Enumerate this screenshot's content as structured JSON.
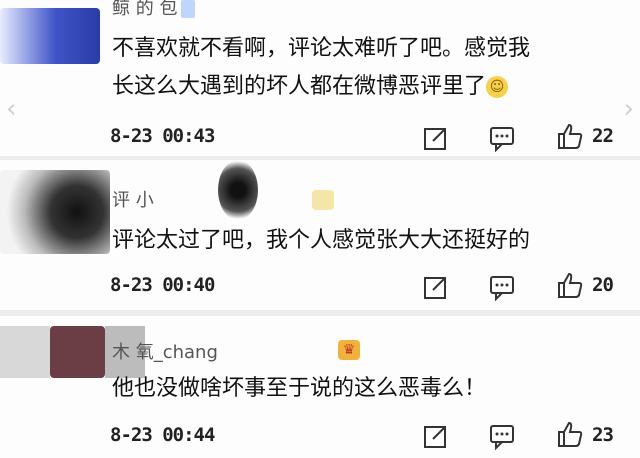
{
  "comments": [
    {
      "name": "鲸    的    包",
      "text_line1": "不喜欢就不看啊，评论太难听了吧。感觉我",
      "text_line2": "长这么大遇到的坏人都在微博恶评里了",
      "time": "8-23 00:43",
      "likes": "22"
    },
    {
      "name": "评    小",
      "text": "评论太过了吧，我个人感觉张大大还挺好的",
      "time": "8-23 00:40",
      "likes": "20"
    },
    {
      "name": "木    氧_chang",
      "text": "他也没做啥坏事至于说的这么恶毒么！",
      "time": "8-23 00:44",
      "likes": "23"
    }
  ],
  "icons": {
    "smile": "☺",
    "crown": "♛"
  },
  "colors": {
    "background": "#f5f5f5",
    "avatar_blue": "#2b3ba6",
    "avatar_maroon": "#6b3d44",
    "emoji_yellow": "#f7d14a"
  }
}
